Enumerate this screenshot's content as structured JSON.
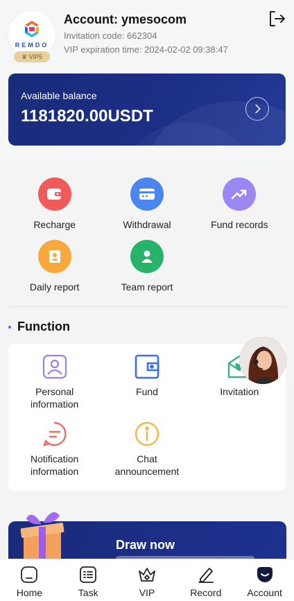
{
  "account": {
    "title": "Account: ymesocom",
    "invitation": "Invitation code: 662304",
    "vip_expiry": "VIP expiration time: 2024-02-02 09:38:47",
    "logo_text": "REMDO",
    "vip_level": "VIP5"
  },
  "balance": {
    "label": "Available balance",
    "value": "1181820.00USDT"
  },
  "quick_actions": [
    {
      "label": "Recharge",
      "icon": "wallet-icon",
      "color": "#f15a5a"
    },
    {
      "label": "Withdrawal",
      "icon": "card-icon",
      "color": "#4b86f0"
    },
    {
      "label": "Fund records",
      "icon": "trend-icon",
      "color": "#9b87f2"
    },
    {
      "label": "Daily report",
      "icon": "report-icon",
      "color": "#f7a93b"
    },
    {
      "label": "Team report",
      "icon": "team-icon",
      "color": "#27b36a"
    }
  ],
  "function": {
    "title": "Function",
    "items": [
      {
        "label": "Personal information",
        "icon": "user-card-icon",
        "color": "#9b7ff0"
      },
      {
        "label": "Fund",
        "icon": "fund-icon",
        "color": "#3a6cf0"
      },
      {
        "label": "Invitation",
        "icon": "invitation-icon",
        "color": "#36b37e"
      },
      {
        "label": "Notification information",
        "icon": "message-icon",
        "color": "#ef6a5e"
      },
      {
        "label": "Chat announcement",
        "icon": "info-icon",
        "color": "#f5b63b"
      }
    ]
  },
  "banner": {
    "title": "Draw now"
  },
  "tabs": [
    {
      "label": "Home",
      "icon": "home-icon"
    },
    {
      "label": "Task",
      "icon": "task-icon"
    },
    {
      "label": "VIP",
      "icon": "crown-icon"
    },
    {
      "label": "Record",
      "icon": "edit-icon"
    },
    {
      "label": "Account",
      "icon": "account-icon",
      "active": true
    }
  ]
}
